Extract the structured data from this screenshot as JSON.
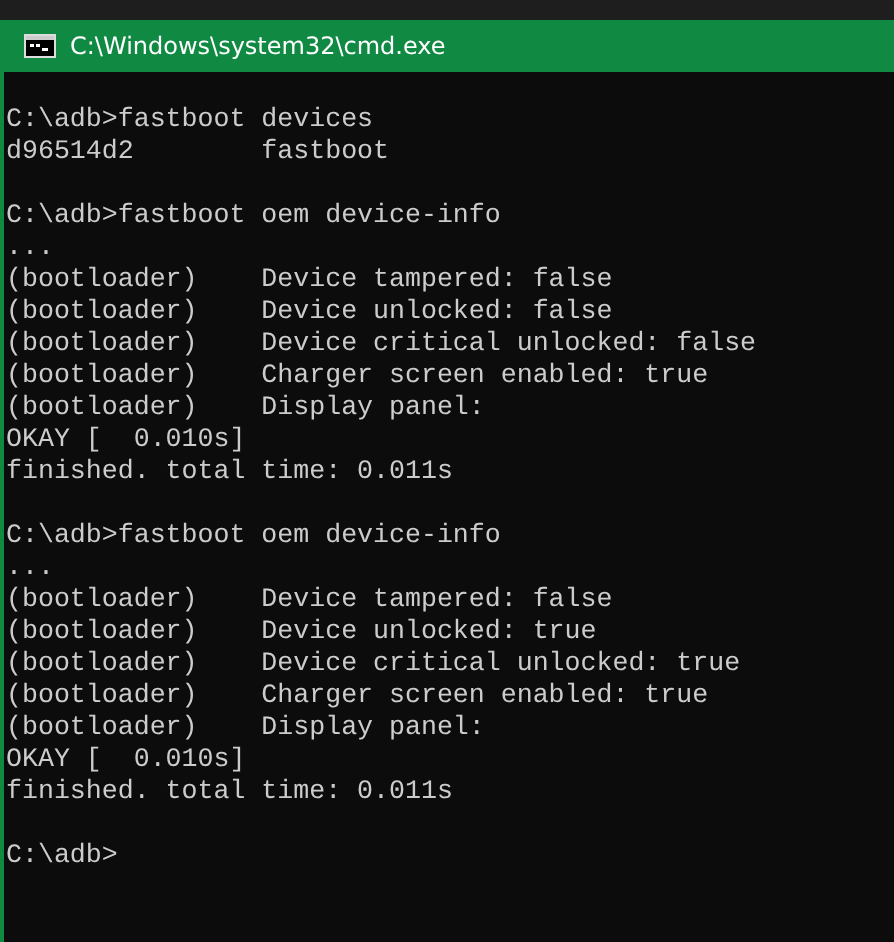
{
  "window": {
    "title": "C:\\Windows\\system32\\cmd.exe"
  },
  "console_blocks": [
    [
      "C:\\adb>fastboot devices",
      "d96514d2        fastboot"
    ],
    [
      "C:\\adb>fastboot oem device-info",
      "...",
      "(bootloader)    Device tampered: false",
      "(bootloader)    Device unlocked: false",
      "(bootloader)    Device critical unlocked: false",
      "(bootloader)    Charger screen enabled: true",
      "(bootloader)    Display panel:",
      "OKAY [  0.010s]",
      "finished. total time: 0.011s"
    ],
    [
      "C:\\adb>fastboot oem device-info",
      "...",
      "(bootloader)    Device tampered: false",
      "(bootloader)    Device unlocked: true",
      "(bootloader)    Device critical unlocked: true",
      "(bootloader)    Charger screen enabled: true",
      "(bootloader)    Display panel:",
      "OKAY [  0.010s]",
      "finished. total time: 0.011s"
    ],
    [
      "C:\\adb>"
    ]
  ]
}
